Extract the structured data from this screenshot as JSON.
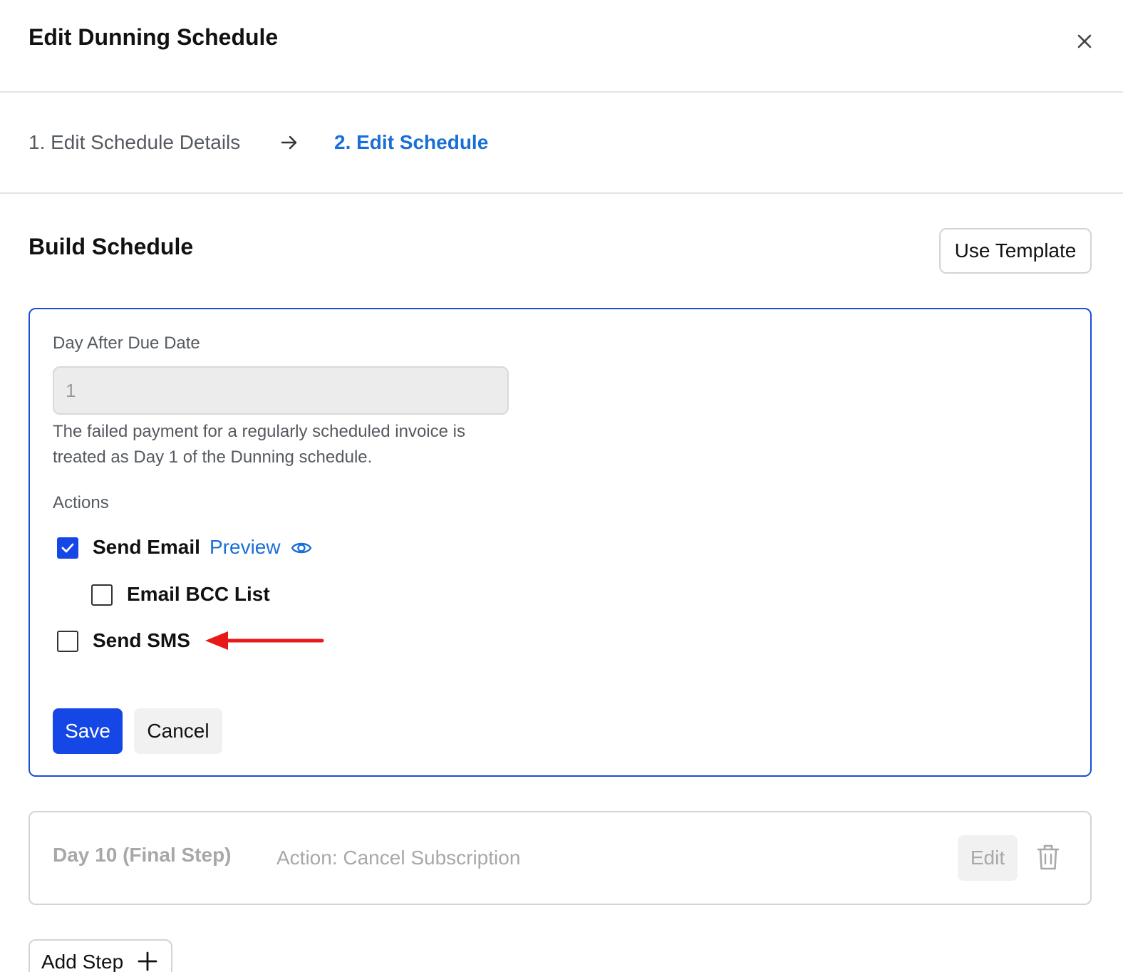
{
  "modal": {
    "title": "Edit Dunning Schedule",
    "close_icon": "close-icon"
  },
  "stepper": {
    "step1_label": "1. Edit Schedule Details",
    "arrow_icon": "arrow-right-icon",
    "step2_label": "2. Edit Schedule",
    "active_color": "#1a6fd6"
  },
  "build": {
    "title": "Build Schedule",
    "use_template_label": "Use Template"
  },
  "active_step": {
    "field_label": "Day After Due Date",
    "day_value": "1",
    "helper_text": "The failed payment for a regularly scheduled invoice is treated as Day 1 of the Dunning schedule.",
    "actions_label": "Actions",
    "actions": [
      {
        "label": "Send Email",
        "checked": true
      },
      {
        "label": "Email BCC List",
        "checked": false
      },
      {
        "label": "Send SMS",
        "checked": false
      }
    ],
    "preview_label": "Preview",
    "preview_icon": "eye-icon",
    "annotation_icon": "red-arrow-icon",
    "save_label": "Save",
    "cancel_label": "Cancel",
    "accent_color": "#1447e6"
  },
  "final_step": {
    "title": "Day 10 (Final Step)",
    "action_text": "Action: Cancel Subscription",
    "edit_label": "Edit",
    "delete_icon": "trash-icon"
  },
  "add_step": {
    "label": "Add Step",
    "icon": "plus-icon"
  }
}
